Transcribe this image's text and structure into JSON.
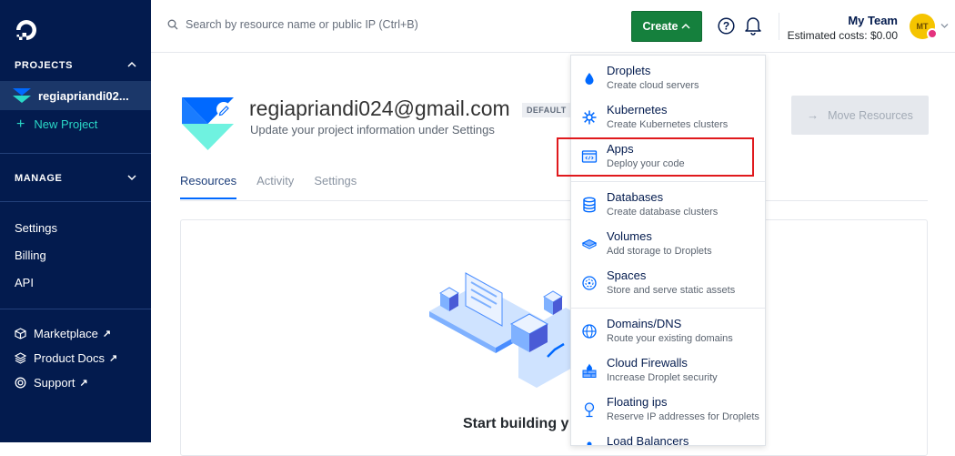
{
  "sidebar": {
    "projects_title": "PROJECTS",
    "current_project": "regiapriandi02...",
    "new_project": "New Project",
    "manage_title": "MANAGE",
    "links": [
      "Settings",
      "Billing",
      "API"
    ],
    "external": [
      {
        "label": "Marketplace",
        "icon": "box-icon"
      },
      {
        "label": "Product Docs",
        "icon": "docs-icon"
      },
      {
        "label": "Support",
        "icon": "support-icon"
      }
    ],
    "external_arrow": "↗"
  },
  "topbar": {
    "search_placeholder": "Search by resource name or public IP (Ctrl+B)",
    "create_label": "Create",
    "team_name": "My Team",
    "estimated_costs": "Estimated costs: $0.00",
    "avatar_initials": "MT"
  },
  "project": {
    "email": "regiapriandi024@gmail.com",
    "badge": "DEFAULT",
    "subtitle": "Update your project information under Settings",
    "move_resources": "Move Resources",
    "move_arrow": "→"
  },
  "tabs": [
    "Resources",
    "Activity",
    "Settings"
  ],
  "empty_state": {
    "heading": "Start building y"
  },
  "create_menu": {
    "items": [
      {
        "title": "Droplets",
        "desc": "Create cloud servers",
        "icon": "droplet-icon"
      },
      {
        "title": "Kubernetes",
        "desc": "Create Kubernetes clusters",
        "icon": "kubernetes-icon"
      },
      {
        "title": "Apps",
        "desc": "Deploy your code",
        "icon": "apps-icon"
      },
      {
        "title": "Databases",
        "desc": "Create database clusters",
        "icon": "database-icon"
      },
      {
        "title": "Volumes",
        "desc": "Add storage to Droplets",
        "icon": "volume-icon"
      },
      {
        "title": "Spaces",
        "desc": "Store and serve static assets",
        "icon": "spaces-icon"
      },
      {
        "title": "Domains/DNS",
        "desc": "Route your existing domains",
        "icon": "globe-icon"
      },
      {
        "title": "Cloud Firewalls",
        "desc": "Increase Droplet security",
        "icon": "firewall-icon"
      },
      {
        "title": "Floating ips",
        "desc": "Reserve IP addresses for Droplets",
        "icon": "floating-ip-icon"
      },
      {
        "title": "Load Balancers",
        "desc": "",
        "icon": "load-balancer-icon"
      }
    ]
  },
  "colors": {
    "sidebar_bg": "#031b4e",
    "accent": "#0069ff",
    "create_green": "#15803d",
    "highlight_red": "#e0191d",
    "new_project_teal": "#2ad8c7"
  }
}
